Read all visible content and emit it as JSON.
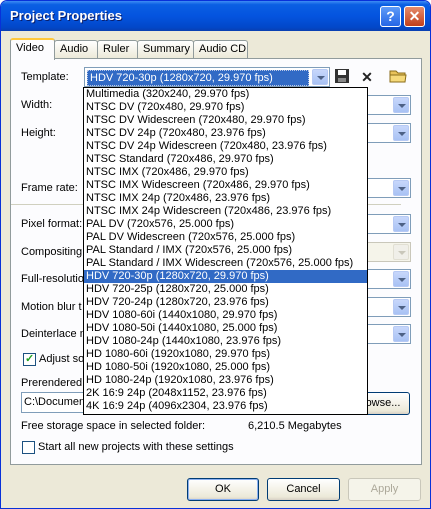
{
  "window": {
    "title": "Project Properties",
    "help_label": "?",
    "close_label": "✕"
  },
  "tabs": [
    {
      "label": "Video",
      "active": true
    },
    {
      "label": "Audio"
    },
    {
      "label": "Ruler"
    },
    {
      "label": "Summary"
    },
    {
      "label": "Audio CD"
    }
  ],
  "template": {
    "label": "Template:",
    "value": "HDV 720-30p (1280x720, 29.970 fps)",
    "options": [
      "Multimedia (320x240, 29.970 fps)",
      "NTSC DV (720x480, 29.970 fps)",
      "NTSC DV Widescreen (720x480, 29.970 fps)",
      "NTSC DV 24p (720x480, 23.976 fps)",
      "NTSC DV 24p Widescreen (720x480, 23.976 fps)",
      "NTSC Standard (720x486, 29.970 fps)",
      "NTSC IMX (720x486, 29.970 fps)",
      "NTSC IMX Widescreen (720x486, 29.970 fps)",
      "NTSC IMX 24p (720x486, 23.976 fps)",
      "NTSC IMX 24p Widescreen (720x486, 23.976 fps)",
      "PAL DV (720x576, 25.000 fps)",
      "PAL DV Widescreen (720x576, 25.000 fps)",
      "PAL Standard / IMX (720x576, 25.000 fps)",
      "PAL Standard / IMX Widescreen (720x576, 25.000 fps)",
      "HDV 720-30p (1280x720, 29.970 fps)",
      "HDV 720-25p (1280x720, 25.000 fps)",
      "HDV 720-24p (1280x720, 23.976 fps)",
      "HDV 1080-60i (1440x1080, 29.970 fps)",
      "HDV 1080-50i (1440x1080, 25.000 fps)",
      "HDV 1080-24p (1440x1080, 23.976 fps)",
      "HD 1080-60i (1920x1080, 29.970 fps)",
      "HD 1080-50i (1920x1080, 25.000 fps)",
      "HD 1080-24p (1920x1080, 23.976 fps)",
      "2K 16:9 24p (2048x1152, 23.976 fps)",
      "4K 16:9 24p (4096x2304, 23.976 fps)"
    ],
    "highlighted_index": 14
  },
  "fields": {
    "width_label": "Width:",
    "height_label": "Height:",
    "frame_rate_label": "Frame rate:",
    "pixel_format_label": "Pixel format:",
    "compositing_label": "Compositing",
    "full_resolution_label": "Full-resolutio",
    "motion_blur_label": "Motion blur t",
    "deinterlace_label": "Deinterlace m"
  },
  "adjust": {
    "label": "Adjust so",
    "checked": true
  },
  "prerendered": {
    "label": "Prerendered",
    "path": "C:\\Documen",
    "browse_label": "owse..."
  },
  "storage": {
    "label": "Free storage space in selected folder:",
    "value": "6,210.5 Megabytes"
  },
  "start_all": {
    "label": "Start all new projects with these settings",
    "checked": false
  },
  "buttons": {
    "ok": "OK",
    "cancel": "Cancel",
    "apply": "Apply"
  }
}
